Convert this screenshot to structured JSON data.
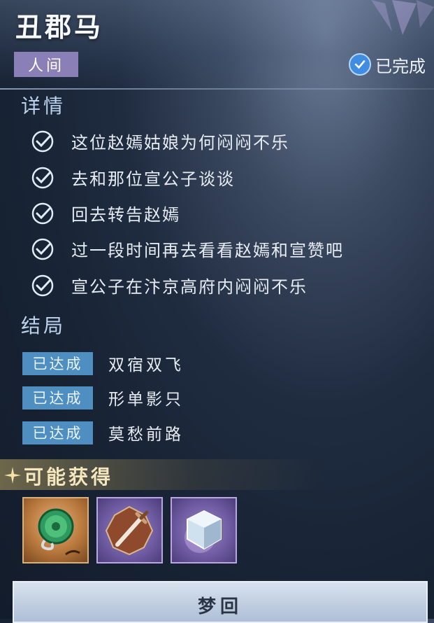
{
  "header": {
    "title": "丑郡马",
    "tag": "人间",
    "status_label": "已完成",
    "status_icon": "check-circle-icon"
  },
  "details": {
    "heading": "详情",
    "tasks": [
      "这位赵嫣姑娘为何闷闷不乐",
      "去和那位宣公子谈谈",
      "回去转告赵嫣",
      "过一段时间再去看看赵嫣和宣赞吧",
      "宣公子在汴京高府内闷闷不乐"
    ],
    "task_icon": "check-icon"
  },
  "endings": {
    "heading": "结局",
    "items": [
      {
        "badge": "已达成",
        "text": "双宿双飞"
      },
      {
        "badge": "已达成",
        "text": "形单影只"
      },
      {
        "badge": "已达成",
        "text": "莫愁前路"
      }
    ]
  },
  "rewards": {
    "heading": "可能获得",
    "items": [
      {
        "icon": "jade-pendant-icon",
        "rarity_color": "#c98f50"
      },
      {
        "icon": "dagger-icon",
        "rarity_color": "#7f6bb3"
      },
      {
        "icon": "ice-crystal-icon",
        "rarity_color": "#7f6bb3"
      }
    ]
  },
  "footer": {
    "button_label": "梦回"
  },
  "colors": {
    "tag_bg": "#8a7fb6",
    "badge_bg": "#4e8ec0",
    "accent_check": "#3e8de3",
    "section_title": "#bcd3ee",
    "reward_title": "#f4e6bd"
  }
}
